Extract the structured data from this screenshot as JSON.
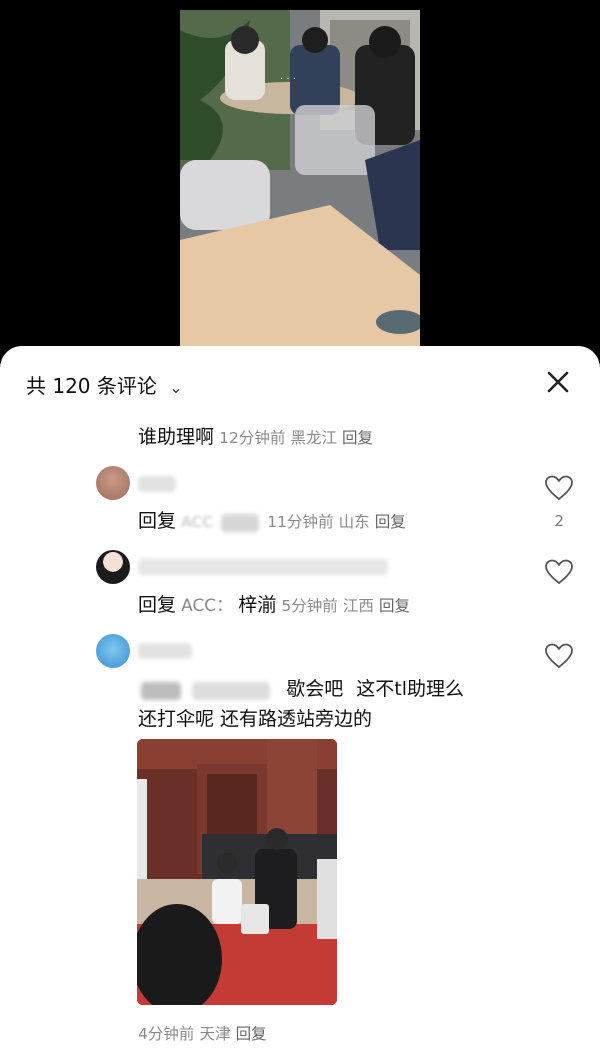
{
  "sheet": {
    "title": "共 120 条评论",
    "chevron_icon": "chevron-down-icon",
    "close_icon": "close-icon"
  },
  "comments": [
    {
      "text": "谁助理啊",
      "time": "12分钟前",
      "location": "黑龙江",
      "reply_label": "回复"
    },
    {
      "reply_prefix": "回复",
      "mention": "ACC",
      "time": "11分钟前",
      "location": "山东",
      "reply_label": "回复",
      "likes": "2"
    },
    {
      "reply_prefix": "回复",
      "mention": "ACC：",
      "name": "梓湔",
      "time": "5分钟前",
      "location": "江西",
      "reply_label": "回复"
    },
    {
      "text_part1": "歇会吧",
      "text_part2": "这不tl助理么",
      "text_line2": "还打伞呢 还有路透站旁边的",
      "time": "4分钟前",
      "location": "天津",
      "reply_label": "回复"
    }
  ],
  "colors": {
    "sheet_bg": "#ffffff",
    "text": "#111111",
    "meta": "#8a8a8a"
  }
}
